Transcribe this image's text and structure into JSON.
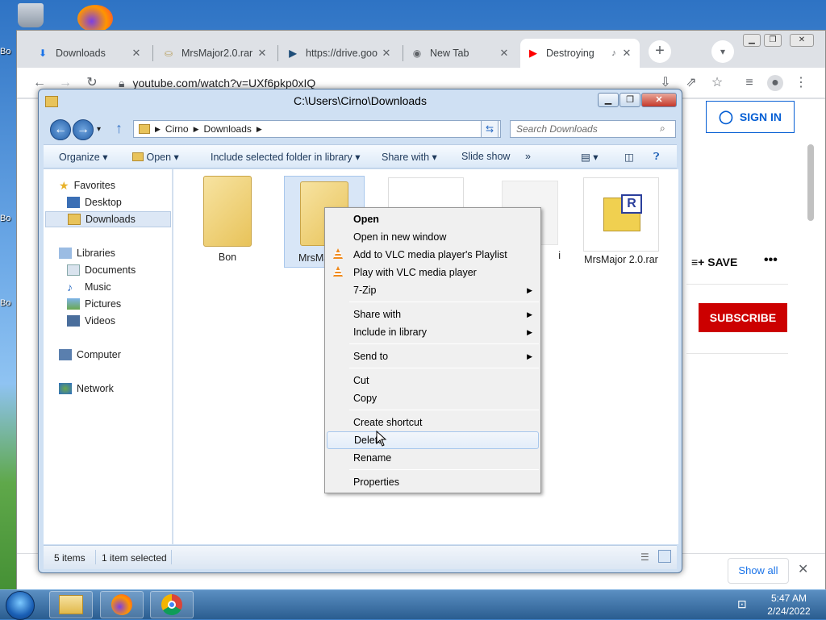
{
  "desktop": {
    "icon_labels": [
      "Bo",
      "Bo",
      "Bo"
    ]
  },
  "chrome": {
    "tabs": [
      {
        "title": "Downloads",
        "icon": "download-icon"
      },
      {
        "title": "MrsMajor2.0.rar",
        "icon": "file-icon"
      },
      {
        "title": "https://drive.goo",
        "icon": "drive-icon"
      },
      {
        "title": "New Tab",
        "icon": "chrome-icon"
      },
      {
        "title": "Destroying",
        "icon": "youtube-icon"
      }
    ],
    "url": "youtube.com/watch?v=UXf6pkp0xIQ"
  },
  "youtube": {
    "sign_in": "SIGN IN",
    "save": "SAVE",
    "subscribe": "SUBSCRIBE",
    "more": "•••",
    "colors": {
      "brand": "#cc0000",
      "link": "#065fd4"
    }
  },
  "downloads_bar": {
    "show_all": "Show all"
  },
  "explorer": {
    "title": "C:\\Users\\Cirno\\Downloads",
    "breadcrumb": [
      "Cirno",
      "Downloads"
    ],
    "search_placeholder": "Search Downloads",
    "commands": [
      "Organize",
      "Open",
      "Include selected folder in library",
      "Share with",
      "Slide show",
      "»"
    ],
    "nav": {
      "favorites": "Favorites",
      "desktop": "Desktop",
      "downloads": "Downloads",
      "libraries": "Libraries",
      "documents": "Documents",
      "music": "Music",
      "pictures": "Pictures",
      "videos": "Videos",
      "computer": "Computer",
      "network": "Network"
    },
    "files": [
      {
        "name": "Bon",
        "type": "folder"
      },
      {
        "name": "MrsMa",
        "type": "folder"
      },
      {
        "name": "",
        "type": "file"
      },
      {
        "name": "i",
        "type": "file"
      },
      {
        "name": "MrsMajor 2.0.rar",
        "type": "rar"
      }
    ],
    "status_count": "5 items",
    "status_selected": "1 item selected"
  },
  "context_menu": {
    "open": "Open",
    "open_new": "Open in new window",
    "vlc_playlist": "Add to VLC media player's Playlist",
    "vlc_play": "Play with VLC media player",
    "zip": "7-Zip",
    "share_with": "Share with",
    "include_library": "Include in library",
    "send_to": "Send to",
    "cut": "Cut",
    "copy": "Copy",
    "create_shortcut": "Create shortcut",
    "delete": "Delete",
    "rename": "Rename",
    "properties": "Properties"
  },
  "taskbar": {
    "time": "5:47 AM",
    "date": "2/24/2022"
  }
}
